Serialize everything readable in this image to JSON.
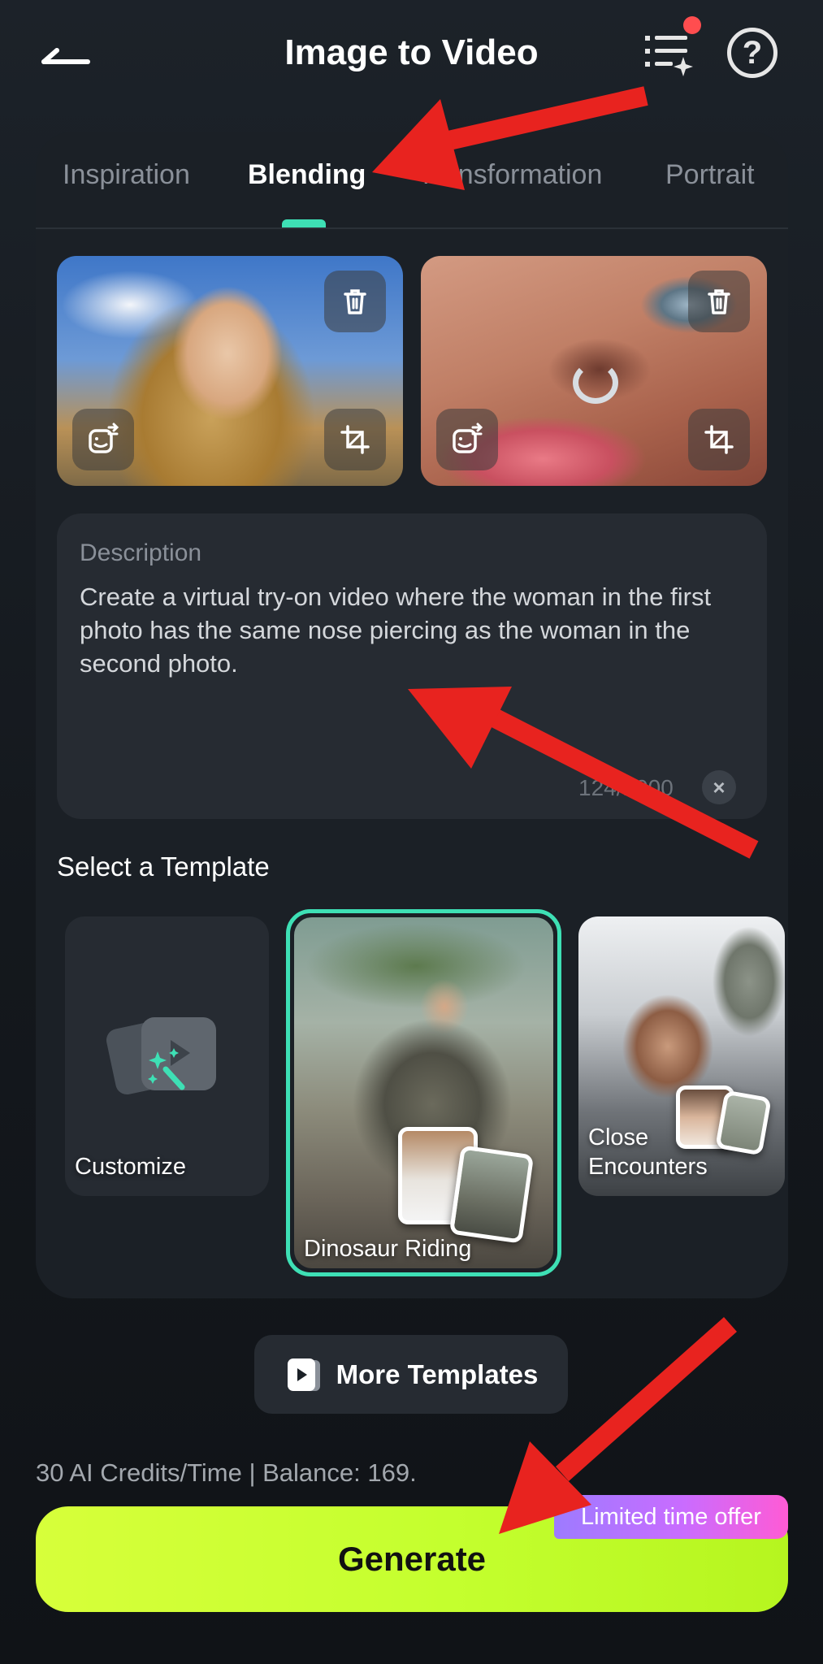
{
  "header": {
    "title": "Image to Video",
    "back_icon": "back-arrow-icon",
    "tasks_icon": "task-list-icon",
    "help_icon": "help-icon",
    "help_glyph": "?"
  },
  "tabs": [
    {
      "label": "Inspiration",
      "active": false
    },
    {
      "label": "Blending",
      "active": true
    },
    {
      "label": "Transformation",
      "active": false
    },
    {
      "label": "Portrait",
      "active": false
    }
  ],
  "description": {
    "label": "Description",
    "value": "Create a virtual try-on video where the woman in the first photo has the same nose piercing as the woman in the second photo.",
    "counter": "124/1000",
    "clear_glyph": "×"
  },
  "templates": {
    "section_title": "Select a Template",
    "items": [
      {
        "label": "Customize",
        "selected": false
      },
      {
        "label": "Dinosaur Riding",
        "selected": true
      },
      {
        "label": "Close Encounters",
        "selected": false
      }
    ],
    "more_label": "More Templates"
  },
  "footer": {
    "credits": "30 AI Credits/Time | Balance: 169.",
    "generate_label": "Generate",
    "offer_badge": "Limited time offer"
  },
  "colors": {
    "accent_teal": "#3ee0b5",
    "generate_green": "#c4ff2e",
    "annotation_red": "#e8231f"
  }
}
